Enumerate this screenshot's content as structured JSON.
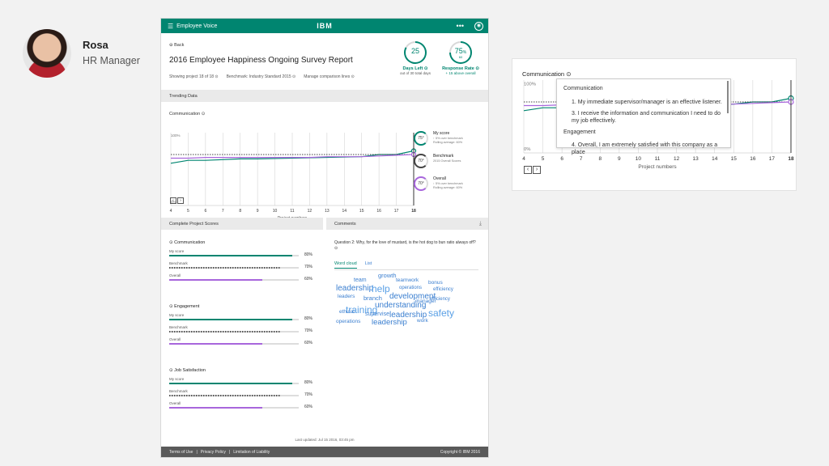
{
  "persona": {
    "name": "Rosa",
    "role": "HR Manager"
  },
  "app": {
    "title": "Employee Voice",
    "brand": "IBM",
    "more_icon": "•••",
    "back": "Back",
    "report_title": "2016 Employee Happiness Ongoing Survey Report",
    "meta": {
      "showing": "Showing project 18 of 18 ⊙",
      "benchmark": "Benchmark: Industry Standard 2015 ⊙",
      "manage": "Manage comparison lines ⊙"
    },
    "kpis": [
      {
        "value": "25",
        "sub": "",
        "label": "Days Left ⊙",
        "detail": "out of 30 total days",
        "progress": 0.83
      },
      {
        "value": "75",
        "sub": "60",
        "label": "Response Rate ⊙",
        "detail": "+ 15 above overall",
        "progress": 0.75
      }
    ],
    "last_updated": "Last updated: Jul 15 2016, 03:45 pm",
    "footer": {
      "links": [
        "Terms of Use",
        "|",
        "Privacy Policy",
        "|",
        "Limitation of Liability"
      ],
      "copyright": "Copyright © IBM 2016"
    }
  },
  "trending": {
    "section_title": "Trending Data",
    "panel_title": "Communication ⊙",
    "legend": [
      {
        "value": "75°",
        "name": "My score",
        "detail": "↑ 5% over benchmark\nRolling average: 60%",
        "color": "#008570"
      },
      {
        "value": "70°",
        "name": "Benchmark",
        "detail": "2015 Overall Scores",
        "color": "#444444"
      },
      {
        "value": "70°",
        "name": "Overall",
        "detail": "↑ 5% over benchmark\nRolling average: 60%",
        "color": "#a866dc"
      }
    ]
  },
  "chart_data": {
    "type": "line",
    "x": [
      4,
      5,
      6,
      7,
      8,
      9,
      10,
      11,
      12,
      13,
      14,
      15,
      16,
      17,
      18
    ],
    "xlabel": "Project numbers",
    "y_ticks": [
      "100%",
      "0%"
    ],
    "ylim": [
      0,
      100
    ],
    "grid": true,
    "series": [
      {
        "name": "My score",
        "color": "#008570",
        "values": [
          58,
          62,
          62,
          63,
          64,
          64,
          64.5,
          null,
          null,
          null,
          null,
          67,
          70,
          70,
          75
        ]
      },
      {
        "name": "Benchmark",
        "color": "#444444",
        "values": [
          70,
          70,
          70,
          70,
          70,
          70,
          70,
          70,
          70,
          70,
          70,
          70,
          70,
          70,
          70
        ]
      },
      {
        "name": "Overall",
        "color": "#a866dc",
        "values": [
          65,
          65,
          66,
          66,
          66,
          66,
          66,
          66,
          66,
          67,
          67,
          67,
          68,
          69,
          70
        ]
      }
    ]
  },
  "scores": {
    "section_title": "Complete Project Scores",
    "groups": [
      {
        "title": "Communication",
        "rows": [
          {
            "label": "My score",
            "value": "80%",
            "fraction": 0.95,
            "color": "#008570"
          },
          {
            "label": "Benchmark",
            "value": "70%",
            "fraction": 0.86,
            "color": "#555555",
            "dashed": true
          },
          {
            "label": "Overall",
            "value": "60%",
            "fraction": 0.72,
            "color": "#a866dc"
          }
        ]
      },
      {
        "title": "Engagement",
        "rows": [
          {
            "label": "My score",
            "value": "80%",
            "fraction": 0.95,
            "color": "#008570"
          },
          {
            "label": "Benchmark",
            "value": "70%",
            "fraction": 0.86,
            "color": "#555555",
            "dashed": true
          },
          {
            "label": "Overall",
            "value": "60%",
            "fraction": 0.72,
            "color": "#a866dc"
          }
        ]
      },
      {
        "title": "Job Satisfaction",
        "rows": [
          {
            "label": "My score",
            "value": "80%",
            "fraction": 0.95,
            "color": "#008570"
          },
          {
            "label": "Benchmark",
            "value": "70%",
            "fraction": 0.86,
            "color": "#555555",
            "dashed": true
          },
          {
            "label": "Overall",
            "value": "60%",
            "fraction": 0.72,
            "color": "#a866dc"
          }
        ]
      }
    ]
  },
  "comments": {
    "section_title": "Comments",
    "question": "Question 2: Why, for the love of mustard, is the hot dog to bun ratio always off? ⊙",
    "tabs": [
      "Word cloud",
      "List"
    ],
    "words": [
      {
        "text": "growth",
        "size": 7.5,
        "color": "#3b7fd0"
      },
      {
        "text": "team",
        "size": 7,
        "color": "#3b7fd0"
      },
      {
        "text": "teamwork",
        "size": 6.5,
        "color": "#3b7fd0"
      },
      {
        "text": "bonus",
        "size": 6.5,
        "color": "#3b7fd0"
      },
      {
        "text": "leadership",
        "size": 10,
        "color": "#3b7fd0"
      },
      {
        "text": "help",
        "size": 12,
        "color": "#5aa0e6"
      },
      {
        "text": "operations",
        "size": 6,
        "color": "#3b7fd0"
      },
      {
        "text": "efficiency",
        "size": 6,
        "color": "#3b7fd0"
      },
      {
        "text": "leaders",
        "size": 6.5,
        "color": "#3b7fd0"
      },
      {
        "text": "branch",
        "size": 7.5,
        "color": "#3b7fd0"
      },
      {
        "text": "development",
        "size": 10,
        "color": "#3b7fd0"
      },
      {
        "text": "efficiency",
        "size": 6,
        "color": "#3b7fd0"
      },
      {
        "text": "training",
        "size": 12,
        "color": "#5aa0e6"
      },
      {
        "text": "understanding",
        "size": 10,
        "color": "#3b7fd0"
      },
      {
        "text": "manager",
        "size": 6.5,
        "color": "#3b7fd0"
      },
      {
        "text": "safety",
        "size": 12,
        "color": "#5aa0e6"
      },
      {
        "text": "ethical",
        "size": 6.5,
        "color": "#3b7fd0"
      },
      {
        "text": "supervise",
        "size": 7,
        "color": "#3b7fd0"
      },
      {
        "text": "leadership",
        "size": 10,
        "color": "#3b7fd0"
      },
      {
        "text": "operations",
        "size": 6.5,
        "color": "#3b7fd0"
      },
      {
        "text": "leadership",
        "size": 9.5,
        "color": "#3b7fd0"
      },
      {
        "text": "work",
        "size": 6.5,
        "color": "#3b7fd0"
      }
    ]
  },
  "zoom": {
    "panel_title": "Communication ⊙",
    "tooltip": {
      "heading1": "Communication",
      "q1": "1. My immediate supervisor/manager is an effective listener.",
      "q3": "3. I receive the information and communication I need to do my job effectively.",
      "heading2": "Engagement",
      "q4": "4. Overall, I am extremely satisfied with this company as a place"
    },
    "x": [
      4,
      5,
      6,
      7,
      8,
      9,
      10,
      11,
      12,
      13,
      14,
      15,
      16,
      17,
      18
    ],
    "y_ticks": [
      "100%",
      "0%"
    ],
    "xlabel": "Project numbers"
  }
}
